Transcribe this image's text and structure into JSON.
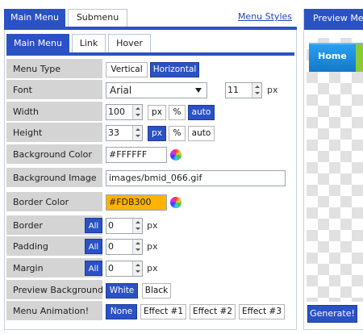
{
  "top_tabs": [
    {
      "label": "Main Menu",
      "active": true
    },
    {
      "label": "Submenu",
      "active": false
    }
  ],
  "menu_styles_link": "Menu Styles",
  "sub_tabs": [
    {
      "label": "Main Menu",
      "active": true
    },
    {
      "label": "Link",
      "active": false
    },
    {
      "label": "Hover",
      "active": false
    }
  ],
  "rows": {
    "menu_type": {
      "label": "Menu Type",
      "options": [
        "Vertical",
        "Horizontal"
      ],
      "selected": "Horizontal"
    },
    "font": {
      "label": "Font",
      "value": "Arial",
      "size": "11",
      "unit": "px"
    },
    "width": {
      "label": "Width",
      "value": "100",
      "units": [
        "px",
        "%",
        "auto"
      ],
      "selected": "auto"
    },
    "height": {
      "label": "Height",
      "value": "33",
      "units": [
        "px",
        "%",
        "auto"
      ],
      "selected": "px"
    },
    "background_color": {
      "label": "Background Color",
      "value": "#FFFFFF"
    },
    "background_image": {
      "label": "Background Image",
      "value": "images/bmid_066.gif"
    },
    "border_color": {
      "label": "Border Color",
      "value": "#FDB300"
    },
    "border": {
      "label": "Border",
      "all": "All",
      "value": "0",
      "unit": "px"
    },
    "padding": {
      "label": "Padding",
      "all": "All",
      "value": "0",
      "unit": "px"
    },
    "margin": {
      "label": "Margin",
      "all": "All",
      "value": "0",
      "unit": "px"
    },
    "preview_background": {
      "label": "Preview Background",
      "options": [
        "White",
        "Black"
      ],
      "selected": "White"
    },
    "menu_animation": {
      "label": "Menu Animation!",
      "options": [
        "None",
        "Effect #1",
        "Effect #2",
        "Effect #3"
      ],
      "selected": "None"
    }
  },
  "preview": {
    "header": "Preview Menu",
    "home_label": "Home",
    "generate_label": "Generate!"
  },
  "colors": {
    "accent": "#2b52c4",
    "border_color_swatch": "#FDB300",
    "label_bg": "#d4d4d4",
    "link": "#2146b8"
  }
}
